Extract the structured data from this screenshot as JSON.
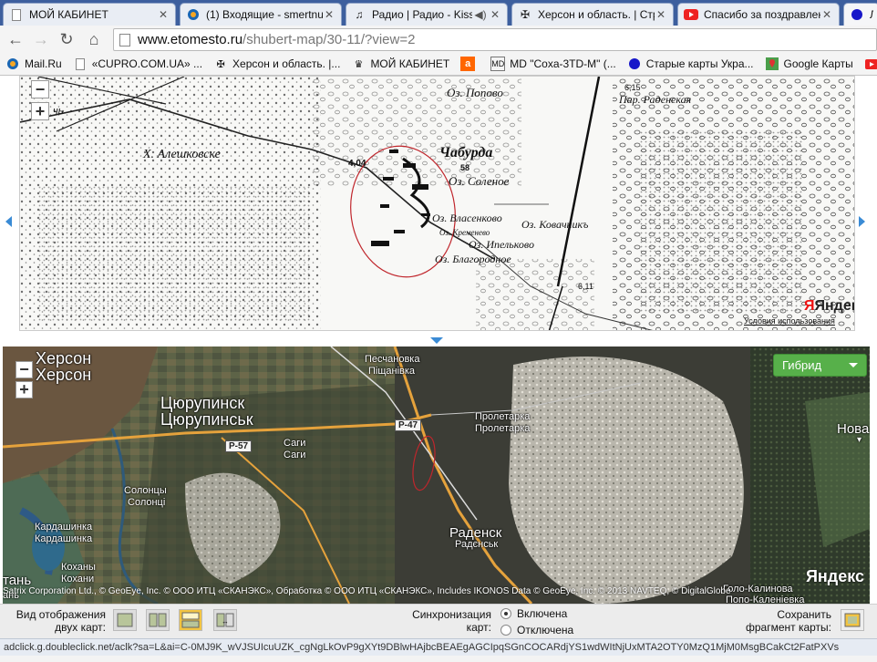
{
  "tabs": [
    {
      "title": "МОЙ КАБИНЕТ",
      "icon": "page-icon"
    },
    {
      "title": "(1) Входящие - smertnu",
      "icon": "mail-ru-icon"
    },
    {
      "title": "Радио | Радио - Kiss",
      "icon": "music-note-icon"
    },
    {
      "title": "Херсон и область. | Стр",
      "icon": "cross-emblem-icon"
    },
    {
      "title": "Спасибо за поздравлен",
      "icon": "youtube-icon"
    },
    {
      "title": "Ли",
      "icon": "blue-circle-icon"
    }
  ],
  "address": {
    "domain": "www.etomesto.ru",
    "path": "/shubert-map/30-11/?view=2"
  },
  "bookmarks": [
    {
      "label": "Mail.Ru",
      "icon": "mail-ru-icon"
    },
    {
      "label": "«CUPRO.COM.UA» ...",
      "icon": "page-icon"
    },
    {
      "label": "Херсон и область. |...",
      "icon": "cross-emblem-icon"
    },
    {
      "label": "МОЙ КАБИНЕТ",
      "icon": "crown-icon"
    },
    {
      "label": "",
      "icon": "orange-a-icon"
    },
    {
      "label": "MD \"Coxa-3TD-M\" (...",
      "icon": "md-icon"
    },
    {
      "label": "Старые карты Укра...",
      "icon": "blue-circle-icon"
    },
    {
      "label": "Google Карты",
      "icon": "google-maps-icon"
    },
    {
      "label": "Y",
      "icon": "youtube-icon"
    }
  ],
  "old_map": {
    "labels": [
      "Х. Алешковске",
      "Оз. Попово",
      "Чабурда",
      "Оз. Соленое",
      "Оз. Власенково",
      "Оз. Ковачникъ",
      "Оз. Кременево",
      "Оз. Ипельково",
      "Оз. Благородное",
      "Пар. Раденская",
      "4,04",
      "58",
      "6,15",
      "6,11",
      "чь"
    ],
    "logo": "Яндекс",
    "terms": "Условия использования"
  },
  "satellite": {
    "map_type": "Гибрид",
    "labels_big": [
      "Херсон",
      "Херсон",
      "Цюрупинск",
      "Цюрупинськ"
    ],
    "labels_mid": [
      "Раденск"
    ],
    "labels_small": [
      "Песчановка",
      "Піщанівка",
      "Пролетарка",
      "Пролетарка",
      "Саги",
      "Саги",
      "Солонцы",
      "Солонці",
      "Кардашинка",
      "Кардашинка",
      "Радєнськ",
      "Коханы",
      "Кохани",
      "Нова",
      "Голо-Калинова",
      "Попо-Каленіевка",
      "тань",
      "ань"
    ],
    "roads": [
      "Р-47",
      "Р-57"
    ],
    "copyright": "Satrix Corporation Ltd., © GeoEye, Inc. © ООО ИТЦ «СКАНЭКС», Обработка © ООО ИТЦ «СКАНЭКС», Includes IKONOS Data © GeoEye, Inc. © 2013 NAVTEQ, © DigitalGlobe",
    "logo": "Яндекс"
  },
  "panel": {
    "view_label": "Вид отображения двух карт:",
    "sync_label": "Синхронизация карт:",
    "sync_on": "Включена",
    "sync_off": "Отключена",
    "save_label": "Сохранить фрагмент карты:"
  },
  "status": "adclick.g.doubleclick.net/aclk?sa=L&ai=C-0MJ9K_wVJSUIcuUZK_cgNgLkOvP9gXYt9DBlwHAjbcBEAEgAGCIpqSGnCOCARdjYS1wdWItNjUxMTA2OTY0MzQ1MjM0MsgBCakCt2FatPXVs"
}
